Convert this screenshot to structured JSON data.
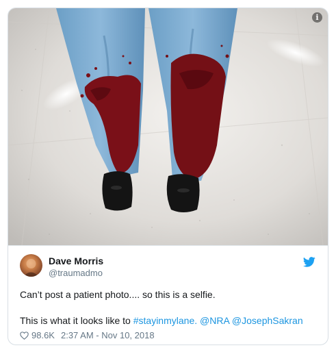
{
  "media": {
    "info_icon_glyph": "i",
    "description_icon": "info-icon"
  },
  "tweet": {
    "author_name": "Dave Morris",
    "author_handle": "@traumadmo",
    "text_line1": "Can’t post a patient photo.... so this is a selfie.",
    "text_line2_prefix": "This is what it looks like to ",
    "hashtag": "#stayinmylane.",
    "mention_1": "@NRA",
    "mention_2": "@JosephSakran",
    "like_count": "98.6K",
    "timestamp": "2:37 AM - Nov 10, 2018"
  },
  "colors": {
    "link": "#1b95e0",
    "text": "#14171a",
    "secondary": "#657786",
    "twitter_blue": "#1da1f2",
    "border": "#d7dee4"
  }
}
